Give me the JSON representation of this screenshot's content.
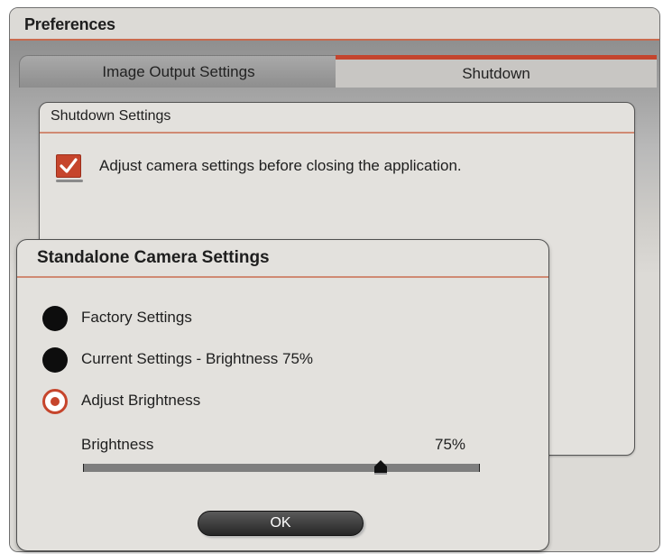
{
  "window": {
    "title": "Preferences"
  },
  "tabs": [
    {
      "label": "Image Output Settings",
      "active": false
    },
    {
      "label": "Shutdown",
      "active": true
    }
  ],
  "shutdown_panel": {
    "title": "Shutdown Settings",
    "checkbox": {
      "label": "Adjust camera settings before closing the application.",
      "checked": true
    }
  },
  "dialog": {
    "title": "Standalone Camera Settings",
    "options": [
      {
        "label": "Factory Settings",
        "selected": false
      },
      {
        "label": "Current Settings - Brightness 75%",
        "selected": false
      },
      {
        "label": "Adjust Brightness",
        "selected": true
      }
    ],
    "brightness": {
      "label": "Brightness",
      "value_text": "75%",
      "value": 75
    },
    "ok_label": "OK"
  },
  "colors": {
    "accent": "#c6452c",
    "button": "#2e2e2e"
  }
}
